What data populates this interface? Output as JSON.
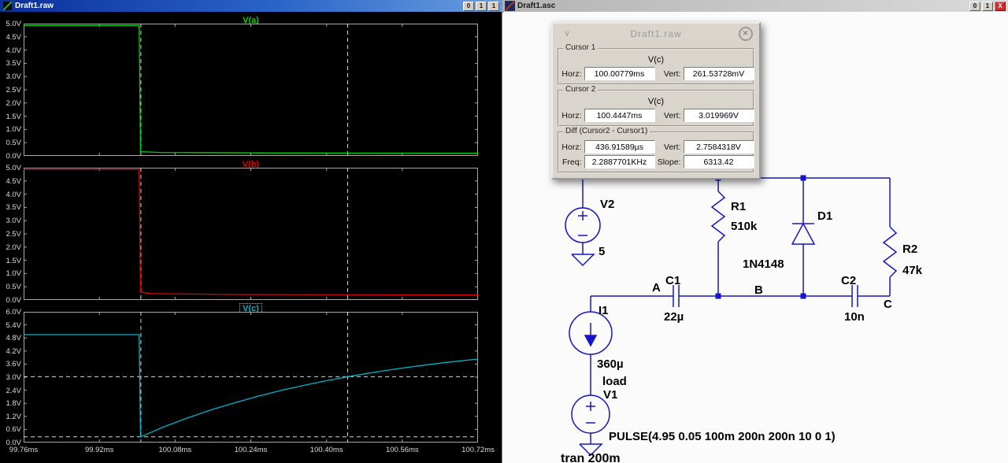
{
  "left_window": {
    "title": "Draft1.raw",
    "window_buttons": [
      "0",
      "1",
      "1"
    ]
  },
  "right_window": {
    "title": "Draft1.asc",
    "window_buttons": [
      "0",
      "1",
      "X"
    ],
    "schematic": {
      "components": {
        "V2": {
          "ref": "V2",
          "value": "5"
        },
        "R1": {
          "ref": "R1",
          "value": "510k"
        },
        "D1": {
          "ref": "D1",
          "value": "1N4148"
        },
        "R2": {
          "ref": "R2",
          "value": "47k"
        },
        "C1": {
          "ref": "C1",
          "value": "22µ"
        },
        "C2": {
          "ref": "C2",
          "value": "10n"
        },
        "I1": {
          "ref": "I1",
          "value": "360µ",
          "extra": "load"
        },
        "V1": {
          "ref": "V1",
          "value": "PULSE(4.95 0.05 100m 200n 200n 10 0 1)"
        }
      },
      "nodes": {
        "a": "A",
        "b": "B",
        "c": "C"
      },
      "directive": "tran 200m",
      "wire_color": "#1616c8"
    }
  },
  "cursor_dialog": {
    "title": "Draft1.raw",
    "collapse_icon": "∨",
    "close_icon": "✕",
    "labels": {
      "horz": "Horz:",
      "vert": "Vert:",
      "freq": "Freq:",
      "slope": "Slope:"
    },
    "cursor1": {
      "group": "Cursor 1",
      "signal": "V(c)",
      "horz": "100.00779ms",
      "vert": "261.53728mV"
    },
    "cursor2": {
      "group": "Cursor 2",
      "signal": "V(c)",
      "horz": "100.4447ms",
      "vert": "3.019969V"
    },
    "diff": {
      "group": "Diff (Cursor2 - Cursor1)",
      "horz": "436.91589µs",
      "vert": "2.7584318V",
      "freq": "2.2887701KHz",
      "slope": "6313.42"
    }
  },
  "chart_data": {
    "type": "line",
    "x_unit": "ms",
    "xlim": [
      99.76,
      100.72
    ],
    "x_ticks": [
      "99.76ms",
      "99.92ms",
      "100.08ms",
      "100.24ms",
      "100.40ms",
      "100.56ms",
      "100.72ms"
    ],
    "grid": false,
    "background": "#000000",
    "panes": [
      {
        "title": "V(a)",
        "color": "#00d400",
        "ylim": [
          0,
          5
        ],
        "y_ticks": [
          "5.0V",
          "4.5V",
          "4.0V",
          "3.5V",
          "3.0V",
          "2.5V",
          "2.0V",
          "1.5V",
          "1.0V",
          "0.5V",
          "0.0V"
        ],
        "points": [
          [
            99.76,
            4.93
          ],
          [
            100.004,
            4.93
          ],
          [
            100.007,
            0.16
          ],
          [
            100.05,
            0.13
          ],
          [
            100.3,
            0.11
          ],
          [
            100.72,
            0.1
          ]
        ]
      },
      {
        "title": "V(b)",
        "color": "#e00000",
        "ylim": [
          0,
          5
        ],
        "y_ticks": [
          "5.0V",
          "4.5V",
          "4.0V",
          "3.5V",
          "3.0V",
          "2.5V",
          "2.0V",
          "1.5V",
          "1.0V",
          "0.5V",
          "0.0V"
        ],
        "points": [
          [
            99.76,
            4.93
          ],
          [
            100.004,
            4.93
          ],
          [
            100.007,
            0.3
          ],
          [
            100.03,
            0.24
          ],
          [
            100.2,
            0.21
          ],
          [
            100.72,
            0.19
          ]
        ]
      },
      {
        "title": "V(c)",
        "color": "#00b4c8",
        "ylim": [
          0,
          6
        ],
        "selected": true,
        "y_ticks": [
          "6.0V",
          "5.4V",
          "4.8V",
          "4.2V",
          "3.6V",
          "3.0V",
          "2.4V",
          "1.8V",
          "1.2V",
          "0.6V",
          "0.0V"
        ],
        "points": [
          [
            99.76,
            4.95
          ],
          [
            100.004,
            4.95
          ],
          [
            100.007,
            0.26
          ],
          [
            100.055,
            0.71
          ],
          [
            100.105,
            1.12
          ],
          [
            100.155,
            1.49
          ],
          [
            100.205,
            1.82
          ],
          [
            100.255,
            2.12
          ],
          [
            100.305,
            2.4
          ],
          [
            100.355,
            2.64
          ],
          [
            100.405,
            2.86
          ],
          [
            100.455,
            3.06
          ],
          [
            100.505,
            3.24
          ],
          [
            100.555,
            3.4
          ],
          [
            100.605,
            3.55
          ],
          [
            100.655,
            3.68
          ],
          [
            100.705,
            3.8
          ],
          [
            100.72,
            3.83
          ]
        ]
      }
    ],
    "cursors": {
      "cursor1": {
        "t_ms": 100.00779,
        "v": 0.26153728
      },
      "cursor2": {
        "t_ms": 100.4447,
        "v": 3.019969
      },
      "h_lines_pane": 2
    }
  }
}
